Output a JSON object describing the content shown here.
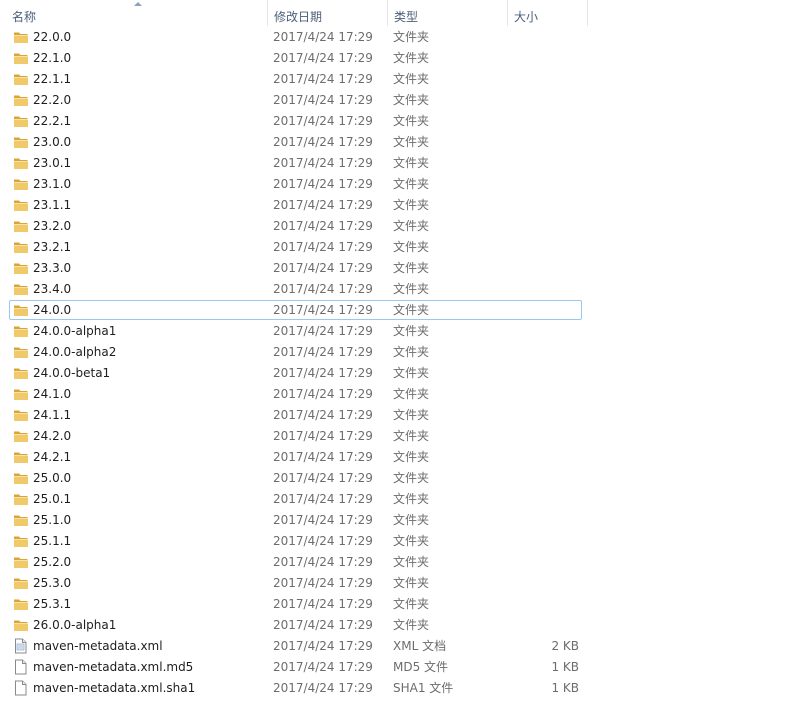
{
  "columns": {
    "name": "名称",
    "date": "修改日期",
    "type": "类型",
    "size": "大小"
  },
  "colors": {
    "header_text": "#4c607a",
    "selection_border": "#99c9ef",
    "folder_body": "#f0c96a",
    "folder_dark": "#d9a536"
  },
  "items": [
    {
      "name": "22.0.0",
      "date": "2017/4/24 17:29",
      "type": "文件夹",
      "size": "",
      "icon": "folder-icon"
    },
    {
      "name": "22.1.0",
      "date": "2017/4/24 17:29",
      "type": "文件夹",
      "size": "",
      "icon": "folder-icon"
    },
    {
      "name": "22.1.1",
      "date": "2017/4/24 17:29",
      "type": "文件夹",
      "size": "",
      "icon": "folder-icon"
    },
    {
      "name": "22.2.0",
      "date": "2017/4/24 17:29",
      "type": "文件夹",
      "size": "",
      "icon": "folder-icon"
    },
    {
      "name": "22.2.1",
      "date": "2017/4/24 17:29",
      "type": "文件夹",
      "size": "",
      "icon": "folder-icon"
    },
    {
      "name": "23.0.0",
      "date": "2017/4/24 17:29",
      "type": "文件夹",
      "size": "",
      "icon": "folder-icon"
    },
    {
      "name": "23.0.1",
      "date": "2017/4/24 17:29",
      "type": "文件夹",
      "size": "",
      "icon": "folder-icon"
    },
    {
      "name": "23.1.0",
      "date": "2017/4/24 17:29",
      "type": "文件夹",
      "size": "",
      "icon": "folder-icon"
    },
    {
      "name": "23.1.1",
      "date": "2017/4/24 17:29",
      "type": "文件夹",
      "size": "",
      "icon": "folder-icon"
    },
    {
      "name": "23.2.0",
      "date": "2017/4/24 17:29",
      "type": "文件夹",
      "size": "",
      "icon": "folder-icon"
    },
    {
      "name": "23.2.1",
      "date": "2017/4/24 17:29",
      "type": "文件夹",
      "size": "",
      "icon": "folder-icon"
    },
    {
      "name": "23.3.0",
      "date": "2017/4/24 17:29",
      "type": "文件夹",
      "size": "",
      "icon": "folder-icon"
    },
    {
      "name": "23.4.0",
      "date": "2017/4/24 17:29",
      "type": "文件夹",
      "size": "",
      "icon": "folder-icon"
    },
    {
      "name": "24.0.0",
      "date": "2017/4/24 17:29",
      "type": "文件夹",
      "size": "",
      "icon": "folder-icon",
      "focused": true
    },
    {
      "name": "24.0.0-alpha1",
      "date": "2017/4/24 17:29",
      "type": "文件夹",
      "size": "",
      "icon": "folder-icon"
    },
    {
      "name": "24.0.0-alpha2",
      "date": "2017/4/24 17:29",
      "type": "文件夹",
      "size": "",
      "icon": "folder-icon"
    },
    {
      "name": "24.0.0-beta1",
      "date": "2017/4/24 17:29",
      "type": "文件夹",
      "size": "",
      "icon": "folder-icon"
    },
    {
      "name": "24.1.0",
      "date": "2017/4/24 17:29",
      "type": "文件夹",
      "size": "",
      "icon": "folder-icon"
    },
    {
      "name": "24.1.1",
      "date": "2017/4/24 17:29",
      "type": "文件夹",
      "size": "",
      "icon": "folder-icon"
    },
    {
      "name": "24.2.0",
      "date": "2017/4/24 17:29",
      "type": "文件夹",
      "size": "",
      "icon": "folder-icon"
    },
    {
      "name": "24.2.1",
      "date": "2017/4/24 17:29",
      "type": "文件夹",
      "size": "",
      "icon": "folder-icon"
    },
    {
      "name": "25.0.0",
      "date": "2017/4/24 17:29",
      "type": "文件夹",
      "size": "",
      "icon": "folder-icon"
    },
    {
      "name": "25.0.1",
      "date": "2017/4/24 17:29",
      "type": "文件夹",
      "size": "",
      "icon": "folder-icon"
    },
    {
      "name": "25.1.0",
      "date": "2017/4/24 17:29",
      "type": "文件夹",
      "size": "",
      "icon": "folder-icon"
    },
    {
      "name": "25.1.1",
      "date": "2017/4/24 17:29",
      "type": "文件夹",
      "size": "",
      "icon": "folder-icon"
    },
    {
      "name": "25.2.0",
      "date": "2017/4/24 17:29",
      "type": "文件夹",
      "size": "",
      "icon": "folder-icon"
    },
    {
      "name": "25.3.0",
      "date": "2017/4/24 17:29",
      "type": "文件夹",
      "size": "",
      "icon": "folder-icon"
    },
    {
      "name": "25.3.1",
      "date": "2017/4/24 17:29",
      "type": "文件夹",
      "size": "",
      "icon": "folder-icon"
    },
    {
      "name": "26.0.0-alpha1",
      "date": "2017/4/24 17:29",
      "type": "文件夹",
      "size": "",
      "icon": "folder-icon"
    },
    {
      "name": "maven-metadata.xml",
      "date": "2017/4/24 17:29",
      "type": "XML 文档",
      "size": "2 KB",
      "icon": "xml-file-icon"
    },
    {
      "name": "maven-metadata.xml.md5",
      "date": "2017/4/24 17:29",
      "type": "MD5 文件",
      "size": "1 KB",
      "icon": "file-icon"
    },
    {
      "name": "maven-metadata.xml.sha1",
      "date": "2017/4/24 17:29",
      "type": "SHA1 文件",
      "size": "1 KB",
      "icon": "file-icon"
    }
  ]
}
